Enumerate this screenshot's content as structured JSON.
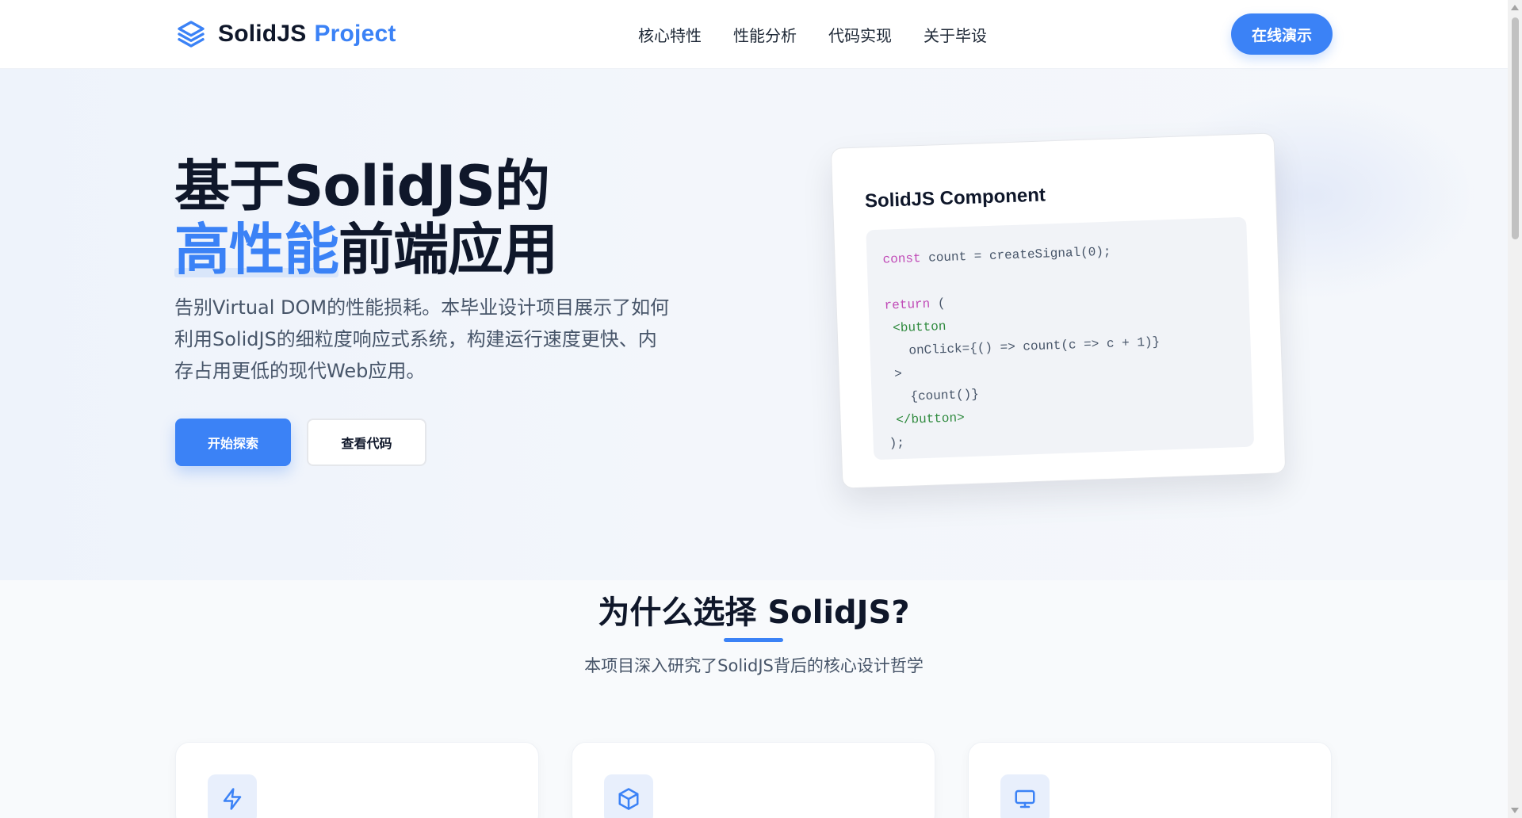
{
  "nav": {
    "logo_icon": "layers-icon",
    "logo_main": "SolidJS",
    "logo_accent": "Project",
    "links": [
      "核心特性",
      "性能分析",
      "代码实现",
      "关于毕设"
    ],
    "cta_label": "在线演示"
  },
  "hero": {
    "title_line1": "基于SolidJS的",
    "title_highlight": "高性能",
    "title_line2_rest": "前端应用",
    "description": "告别Virtual DOM的性能损耗。本毕业设计项目展示了如何利用SolidJS的细粒度响应式系统，构建运行速度更快、内存占用更低的现代Web应用。",
    "primary_button": "开始探索",
    "secondary_button": "查看代码",
    "code_card": {
      "title": "SolidJS Component",
      "lines": [
        {
          "kw": "const",
          "rest": " count = createSignal(0);"
        },
        {
          "kw": "",
          "rest": ""
        },
        {
          "kw": "return",
          "rest": " ("
        },
        {
          "tag": " <button",
          "rest": ""
        },
        {
          "rest": "   onClick={() => count(c => c + 1)}"
        },
        {
          "rest": " >"
        },
        {
          "rest": "   {count()}"
        },
        {
          "tag": " </button>",
          "rest": ""
        },
        {
          "rest": ");"
        }
      ]
    }
  },
  "features": {
    "title": "为什么选择 SolidJS?",
    "subtitle": "本项目深入研究了SolidJS背后的核心设计哲学",
    "cards": [
      {
        "icon": "lightning-icon"
      },
      {
        "icon": "cube-icon"
      },
      {
        "icon": "monitor-icon"
      }
    ]
  },
  "colors": {
    "accent": "#3b82f6",
    "text_dark": "#0f172a",
    "text_muted": "#475569"
  }
}
